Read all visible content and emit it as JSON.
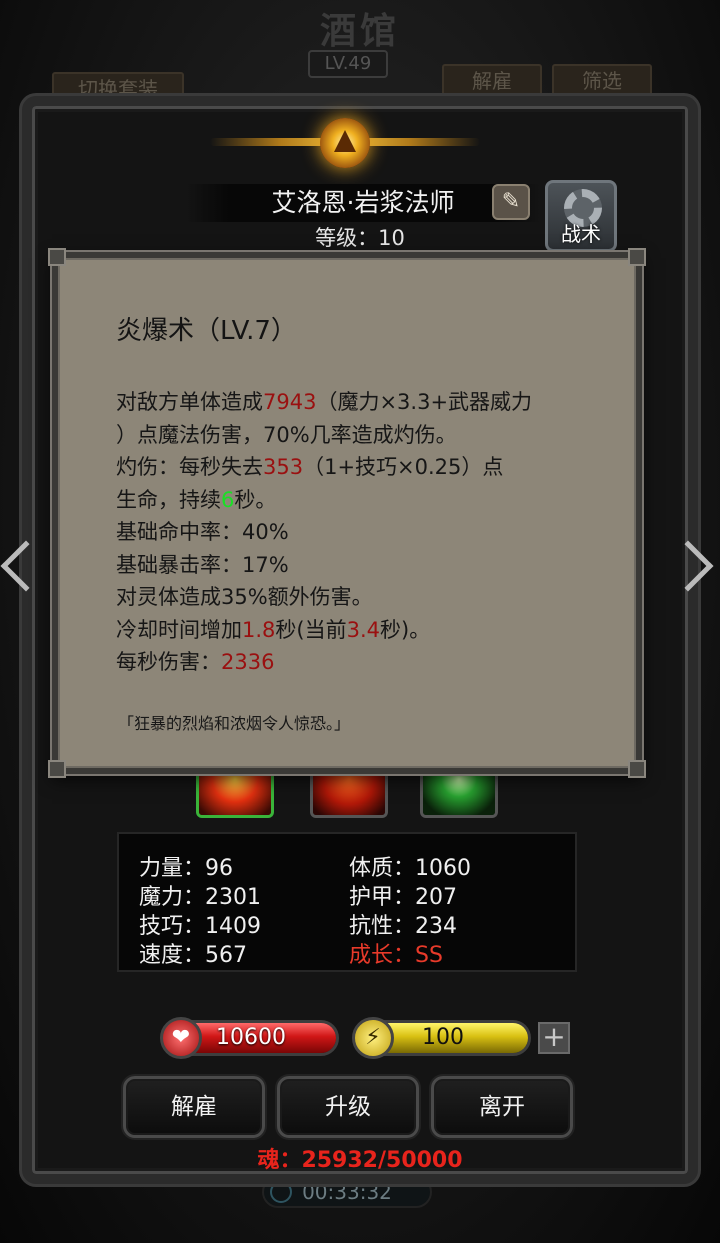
{
  "background": {
    "title": "酒馆",
    "level": "LV.49",
    "switch_outfit": "切换套装",
    "dismiss_top": "解雇",
    "filter": "筛选",
    "timer": "00:33:32"
  },
  "hero": {
    "name": "艾洛恩·岩浆法师",
    "level_label": "等级：10",
    "tactics_label": "战术"
  },
  "tooltip": {
    "title": "炎爆术（LV.7）",
    "line1_a": "对敌方单体造成",
    "line1_dmg": "7943",
    "line1_b": "（魔力×3.3+武器威力",
    "line2": "）点魔法伤害，70%几率造成灼伤。",
    "line3_a": "灼伤：每秒失去",
    "line3_val": "353",
    "line3_b": "（1+技巧×0.25）点",
    "line4_a": "生命，持续",
    "line4_val": "6",
    "line4_b": "秒。",
    "line5": "基础命中率：40%",
    "line6": "基础暴击率：17%",
    "line7": "对灵体造成35%额外伤害。",
    "line8_a": "冷却时间增加",
    "line8_val1": "1.8",
    "line8_b": "秒(当前",
    "line8_val2": "3.4",
    "line8_c": "秒)。",
    "line9_a": "每秒伤害：",
    "line9_val": "2336",
    "quote": "「狂暴的烈焰和浓烟令人惊恐。」"
  },
  "skills": [
    {
      "icon": "fire-blast-skill-icon",
      "selected": true
    },
    {
      "icon": "flame-skill-icon",
      "selected": false
    },
    {
      "icon": "green-orb-skill-icon",
      "selected": false
    }
  ],
  "stats": {
    "strength": "力量：96",
    "magic": "魔力：2301",
    "skill": "技巧：1409",
    "speed": "速度：567",
    "constitution": "体质：1060",
    "armor": "护甲：207",
    "resistance": "抗性：234",
    "growth": "成长：SS"
  },
  "resources": {
    "hp": "10600",
    "energy": "100"
  },
  "actions": {
    "dismiss": "解雇",
    "upgrade": "升级",
    "leave": "离开"
  },
  "soul": "魂：25932/50000",
  "colors": {
    "highlight_red": "#9a1010",
    "highlight_green": "#19e025",
    "growth_red": "#e83a2a",
    "soul_red": "#e8241c"
  }
}
